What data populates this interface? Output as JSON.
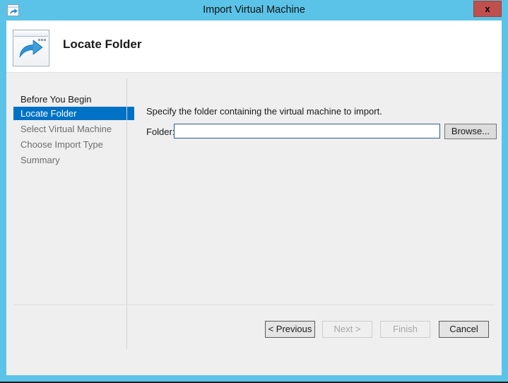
{
  "window": {
    "title": "Import Virtual Machine",
    "titlebar_icon": "import-vm-window-arrow-icon",
    "close_label": "x",
    "frame_color": "#5bc3e7",
    "close_button_color": "#c0504d"
  },
  "header": {
    "icon": "window-with-blue-arrow-icon",
    "title": "Locate Folder"
  },
  "sidebar": {
    "items": [
      {
        "label": "Before You Begin",
        "state": "done"
      },
      {
        "label": "Locate Folder",
        "state": "active"
      },
      {
        "label": "Select Virtual Machine",
        "state": "pending"
      },
      {
        "label": "Choose Import Type",
        "state": "pending"
      },
      {
        "label": "Summary",
        "state": "pending"
      }
    ],
    "active_color": "#0072c6"
  },
  "main": {
    "instruction": "Specify the folder containing the virtual machine to import.",
    "folder_label": "Folder:",
    "folder_value": "",
    "folder_placeholder": "",
    "browse_label": "Browse..."
  },
  "footer": {
    "buttons": [
      {
        "label": "< Previous",
        "enabled": true
      },
      {
        "label": "Next >",
        "enabled": false
      },
      {
        "label": "Finish",
        "enabled": false
      },
      {
        "label": "Cancel",
        "enabled": true
      }
    ]
  }
}
